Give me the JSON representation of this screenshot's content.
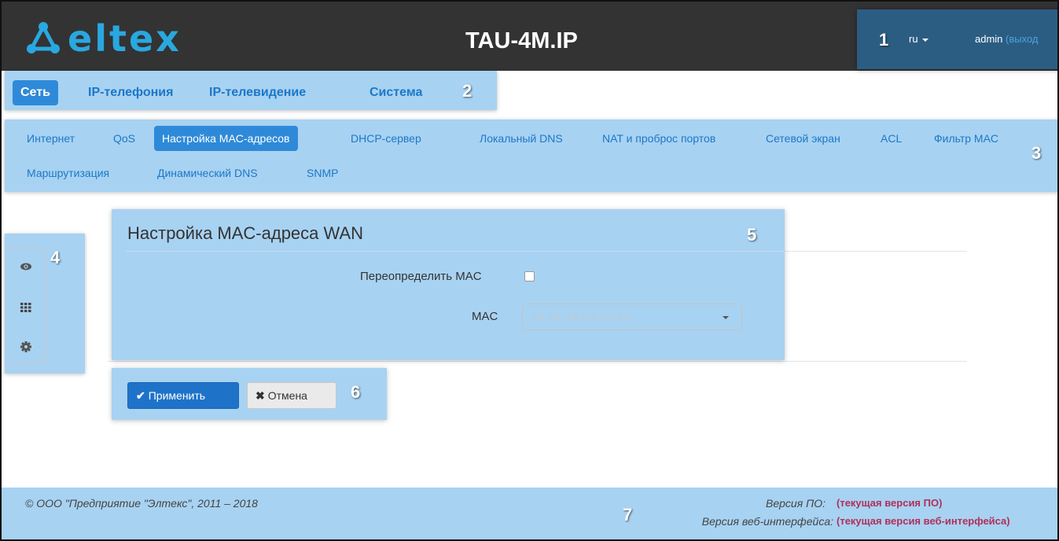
{
  "header": {
    "logo_text": "eltex",
    "device_title": "TAU-4M.IP",
    "language": "ru",
    "user": "admin",
    "logout_label": "(выход",
    "markers": {
      "user_panel": "1"
    }
  },
  "main_nav": {
    "marker": "2",
    "tabs": [
      {
        "label": "Сеть",
        "active": true
      },
      {
        "label": "IP-телефония",
        "active": false
      },
      {
        "label": "IP-телевидение",
        "active": false
      },
      {
        "label": "Система",
        "active": false
      }
    ]
  },
  "sub_nav": {
    "marker": "3",
    "tabs": [
      {
        "label": "Интернет",
        "active": false
      },
      {
        "label": "QoS",
        "active": false
      },
      {
        "label": "Настройка MAC-адресов",
        "active": true
      },
      {
        "label": "DHCP-сервер",
        "active": false
      },
      {
        "label": "Локальный DNS",
        "active": false
      },
      {
        "label": "NAT и проброс портов",
        "active": false
      },
      {
        "label": "Сетевой экран",
        "active": false
      },
      {
        "label": "ACL",
        "active": false
      },
      {
        "label": "Фильтр MAC",
        "active": false
      },
      {
        "label": "Маршрутизация",
        "active": false
      },
      {
        "label": "Динамический DNS",
        "active": false
      },
      {
        "label": "SNMP",
        "active": false
      }
    ]
  },
  "side_toolbar": {
    "marker": "4",
    "icons": [
      "eye-icon",
      "grid-icon",
      "gear-icon"
    ]
  },
  "panel": {
    "marker": "5",
    "title": "Настройка MAC-адреса WAN",
    "override_label": "Переопределить MAC",
    "override_checked": false,
    "mac_label": "MAC",
    "mac_placeholder": "XX:XX:XX:XX:XX:XX"
  },
  "actions": {
    "marker": "6",
    "apply_label": "Применить",
    "cancel_label": "Отмена"
  },
  "footer": {
    "marker": "7",
    "copyright": "© ООО \"Предприятие \"Элтекс\", 2011 – 2018",
    "fw_label": "Версия ПО:",
    "fw_value": "(текущая версия ПО)",
    "web_label": "Версия веб-интерфейса:",
    "web_value": "(текущая версия веб-интерфейса)"
  },
  "colors": {
    "header_bg": "#333333",
    "highlight": "#a8d2f2",
    "accent": "#2e8ad8",
    "brand": "#29a8e0",
    "version_text": "#b0305a"
  }
}
